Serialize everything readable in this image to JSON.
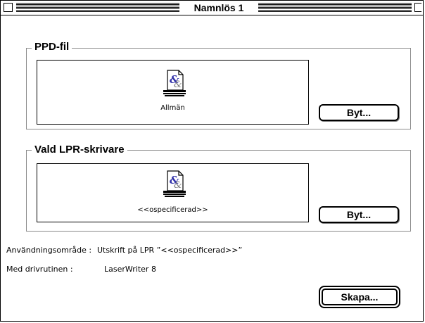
{
  "window": {
    "title": "Namnlös 1"
  },
  "ppd_group": {
    "title": "PPD-fil",
    "file_label": "Allmän",
    "change_button": "Byt..."
  },
  "lpr_group": {
    "title": "Vald LPR-skrivare",
    "printer_label": "<<ospecificerad>>",
    "change_button": "Byt..."
  },
  "info": {
    "usage_label": "Användningsområde :",
    "usage_value": "Utskrift på LPR  ”<<ospecificerad>>”",
    "driver_label": "Med drivrutinen :",
    "driver_value": "LaserWriter 8"
  },
  "create_button": "Skapa...",
  "icons": [
    "close-box-icon",
    "zoom-box-icon",
    "ppd-document-icon",
    "printer-document-icon"
  ]
}
